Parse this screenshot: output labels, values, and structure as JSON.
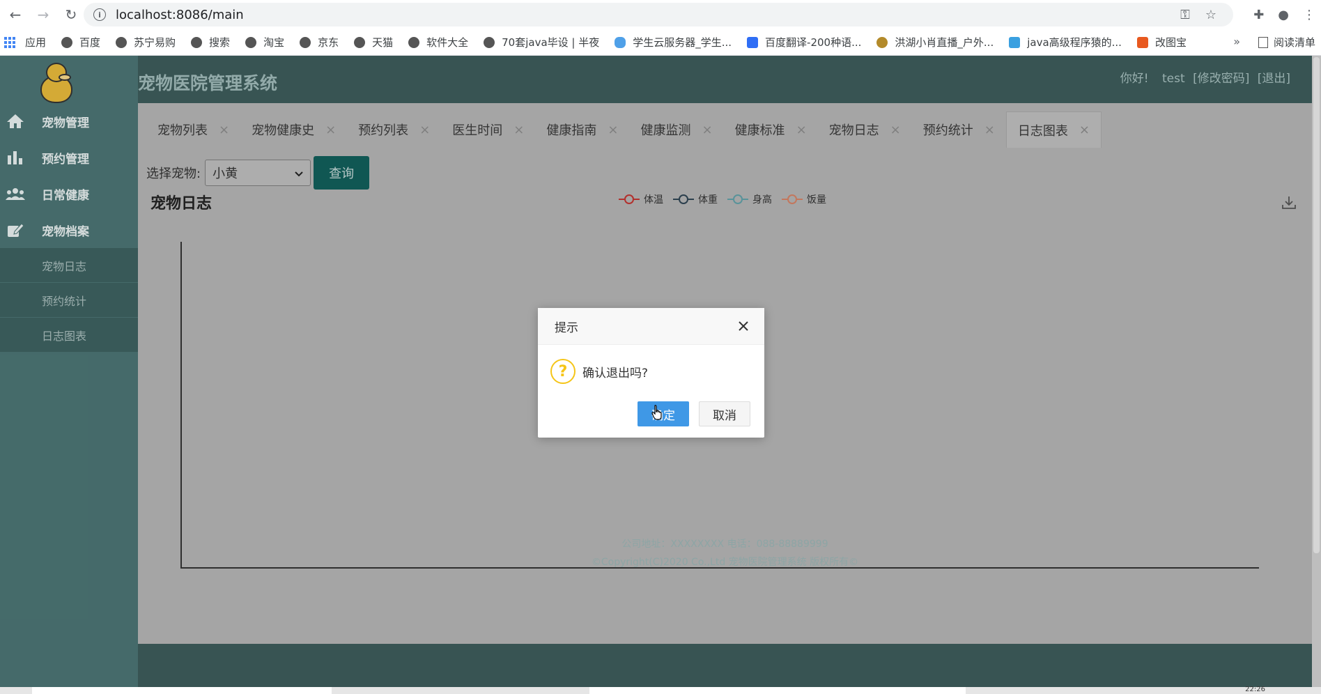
{
  "browser": {
    "url": "localhost:8086/main",
    "bookmarks": [
      {
        "label": "应用"
      },
      {
        "label": "百度"
      },
      {
        "label": "苏宁易购"
      },
      {
        "label": "搜索"
      },
      {
        "label": "淘宝"
      },
      {
        "label": "京东"
      },
      {
        "label": "天猫"
      },
      {
        "label": "软件大全"
      },
      {
        "label": "70套java毕设 | 半夜"
      },
      {
        "label": "学生云服务器_学生..."
      },
      {
        "label": "百度翻译-200种语..."
      },
      {
        "label": "洪湖小肖直播_户外..."
      },
      {
        "label": "java高级程序猿的..."
      },
      {
        "label": "改图宝"
      }
    ],
    "more": "»",
    "reading_list": "阅读清单"
  },
  "header": {
    "title": "宠物医院管理系统",
    "greeting": "你好!",
    "username": "test",
    "change_password": "[修改密码]",
    "logout": "[退出]"
  },
  "sidebar": {
    "menus": [
      {
        "label": "宠物管理",
        "icon": "home-icon"
      },
      {
        "label": "预约管理",
        "icon": "bar-chart-icon"
      },
      {
        "label": "日常健康",
        "icon": "users-icon"
      },
      {
        "label": "宠物档案",
        "icon": "edit-icon"
      }
    ],
    "submenus": [
      {
        "label": "宠物日志"
      },
      {
        "label": "预约统计"
      },
      {
        "label": "日志图表"
      }
    ]
  },
  "tabs": [
    {
      "label": "宠物列表"
    },
    {
      "label": "宠物健康史"
    },
    {
      "label": "预约列表"
    },
    {
      "label": "医生时间"
    },
    {
      "label": "健康指南"
    },
    {
      "label": "健康监测"
    },
    {
      "label": "健康标准"
    },
    {
      "label": "宠物日志"
    },
    {
      "label": "预约统计"
    },
    {
      "label": "日志图表",
      "active": true
    }
  ],
  "tab_close": "×",
  "filter": {
    "label": "选择宠物:",
    "selected": "小黄",
    "query_button": "查询"
  },
  "colors": {
    "series_temp": "#c23531",
    "series_weight": "#2f4554",
    "series_height": "#61a0a8",
    "series_food": "#d48265",
    "accent": "#125f5b",
    "dialog_primary": "#3f98e6"
  },
  "chart_data": {
    "type": "line",
    "title": "宠物日志",
    "legend_position": "top-center",
    "series": [
      {
        "name": "体温",
        "values": []
      },
      {
        "name": "体重",
        "values": []
      },
      {
        "name": "身高",
        "values": []
      },
      {
        "name": "饭量",
        "values": []
      }
    ],
    "x": [],
    "grid": false
  },
  "footer": {
    "address": "公司地址：XXXXXXXX 电话：088-88889999",
    "copyright": "©Copyright(C)2020 Co.,Ltd 宠物医院管理系统 版权所有©"
  },
  "dialog": {
    "title": "提示",
    "message": "确认退出吗?",
    "ok": "确定",
    "cancel": "取消",
    "icon_glyph": "?"
  },
  "taskbar": {
    "time": "22:26"
  }
}
